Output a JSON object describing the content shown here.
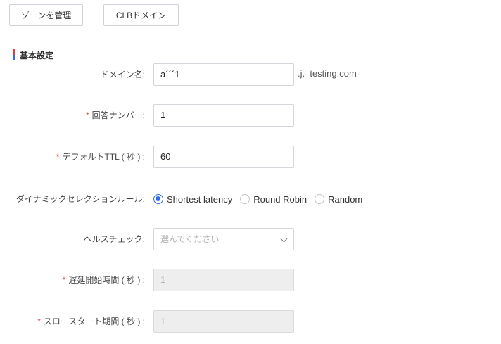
{
  "toolbar": {
    "manage_zone_label": "ゾーンを管理",
    "clb_domain_label": "CLBドメイン"
  },
  "section": {
    "title": "基本設定"
  },
  "form": {
    "domain_name": {
      "label": "ドメイン名:",
      "value": "a´´´1",
      "suffix": ".j.  testing.com"
    },
    "answer_number": {
      "label": "回答ナンバー:",
      "value": "1",
      "required": "*"
    },
    "default_ttl": {
      "label": "デフォルトTTL ( 秒 ) :",
      "value": "60",
      "required": "*"
    },
    "dynamic_selection": {
      "label": "ダイナミックセレクションルール:",
      "options": [
        "Shortest latency",
        "Round Robin",
        "Random"
      ],
      "selected": "Shortest latency"
    },
    "health_check": {
      "label": "ヘルスチェック:",
      "placeholder": "選んでください"
    },
    "delay_start": {
      "label": "遅延開始時間 ( 秒 ) :",
      "value": "1",
      "required": "*"
    },
    "slow_start": {
      "label": "スロースタート期間 ( 秒 ) :",
      "value": "1",
      "required": "*"
    }
  },
  "colors": {
    "accent": "#2f6ee8",
    "required": "#e54545"
  }
}
